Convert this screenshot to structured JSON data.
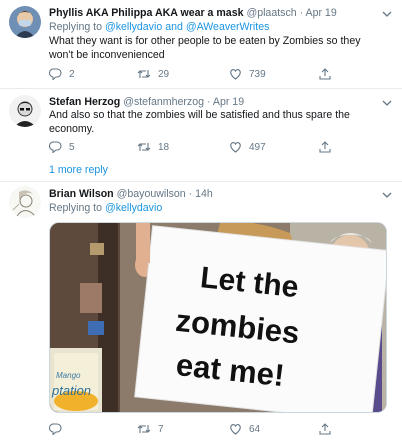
{
  "tweets": [
    {
      "name": "Phyllis AKA Philippa AKA wear a mask",
      "handle": "@plaatsch",
      "sep": "·",
      "date": "Apr 19",
      "replying_prefix": "Replying to",
      "replying_to": [
        "@kellydavio",
        "@AWeaverWrites"
      ],
      "replying_joiner": "and",
      "text_lines": [
        "What they want is for other people to be eaten by Zombies so they",
        "won't be inconvenienced"
      ],
      "replies": "2",
      "retweets": "29",
      "likes": "739"
    },
    {
      "name": "Stefan Herzog",
      "handle": "@stefanmherzog",
      "sep": "·",
      "date": "Apr 19",
      "text_lines": [
        "And also so that the zombies will be satisfied and thus spare the",
        "economy."
      ],
      "replies": "5",
      "retweets": "18",
      "likes": "497"
    },
    {
      "name": "Brian Wilson",
      "handle": "@bayouwilson",
      "sep": "·",
      "date": "14h",
      "replying_prefix": "Replying to",
      "replying_to": [
        "@kellydavio"
      ],
      "replies": "",
      "retweets": "7",
      "likes": "64",
      "image": {
        "sign_lines": [
          "Let the",
          "zombies",
          "eat me!"
        ],
        "storefront_text": [
          "Mango",
          "ptation"
        ]
      }
    }
  ],
  "more_reply_label": "1 more reply",
  "colors": {
    "link": "#1b95e0",
    "muted": "#657786",
    "divider": "#e6ecf0"
  },
  "icons": {
    "reply": "reply-icon",
    "retweet": "retweet-icon",
    "like": "heart-icon",
    "share": "share-icon",
    "more": "chevron-down-icon"
  }
}
